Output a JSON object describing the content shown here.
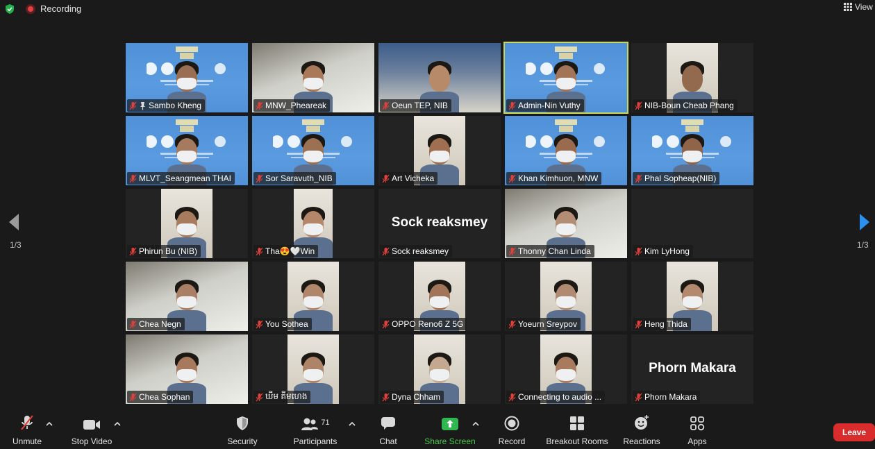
{
  "topbar": {
    "recording_label": "Recording",
    "view_label": "View"
  },
  "pagination": {
    "left_page": "1/3",
    "right_page": "1/3"
  },
  "participants": [
    {
      "name": "Sambo Kheng",
      "pinned": true,
      "bg": "banner"
    },
    {
      "name": "MNW_Pheareak",
      "bg": "room"
    },
    {
      "name": "Oeun TEP, NIB",
      "bg": "office"
    },
    {
      "name": "Admin-Nin Vuthy",
      "bg": "banner",
      "active": true
    },
    {
      "name": "NIB-Boun Cheab Phang",
      "bg": "cam"
    },
    {
      "name": "MLVT_Seangmean THAI",
      "bg": "banner"
    },
    {
      "name": "Sor Saravuth_NIB",
      "bg": "banner"
    },
    {
      "name": "Art Vicheka",
      "bg": "cam"
    },
    {
      "name": "Khan Kimhuon, MNW",
      "bg": "banner"
    },
    {
      "name": "Phal Sopheap(NIB)",
      "bg": "banner"
    },
    {
      "name": "Phirun Bu (NIB)",
      "bg": "cam"
    },
    {
      "name": "Tha😍🤍Win",
      "bg": "cam"
    },
    {
      "name": "Sock reaksmey",
      "bg": "none",
      "big_name": "Sock reaksmey"
    },
    {
      "name": "Thonny Chan Linda",
      "bg": "room"
    },
    {
      "name": "Kim LyHong",
      "bg": "none"
    },
    {
      "name": "Chea Negn",
      "bg": "room"
    },
    {
      "name": "You Sothea",
      "bg": "cam"
    },
    {
      "name": "OPPO Reno6 Z 5G",
      "bg": "cam"
    },
    {
      "name": "Yoeurn Sreypov",
      "bg": "cam"
    },
    {
      "name": "Heng Thida",
      "bg": "cam"
    },
    {
      "name": "Chea Sophan",
      "bg": "room"
    },
    {
      "name": "ឃីម គីមហេង",
      "bg": "cam"
    },
    {
      "name": "Dyna Chham",
      "bg": "cam"
    },
    {
      "name": "Connecting to audio ...",
      "bg": "cam"
    },
    {
      "name": "Phorn Makara",
      "bg": "none",
      "big_name": "Phorn Makara"
    }
  ],
  "toolbar": {
    "unmute": "Unmute",
    "stop_video": "Stop Video",
    "security": "Security",
    "participants": "Participants",
    "participants_count": "71",
    "chat": "Chat",
    "share_screen": "Share Screen",
    "record": "Record",
    "breakout_rooms": "Breakout Rooms",
    "reactions": "Reactions",
    "apps": "Apps",
    "leave": "Leave"
  },
  "colors": {
    "active_speaker": "#c8d65a",
    "share_green": "#2fb84f",
    "leave_red": "#d92d2d",
    "muted_red": "#e0413b"
  }
}
